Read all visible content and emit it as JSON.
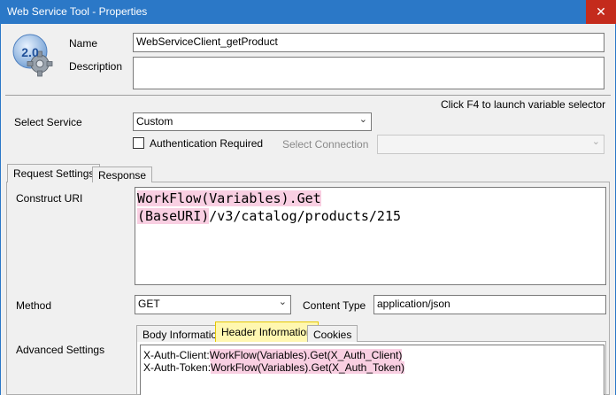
{
  "window": {
    "title": "Web Service Tool - Properties",
    "close_glyph": "✕"
  },
  "icon": {
    "version": "2.0"
  },
  "name": {
    "label": "Name",
    "value": "WebServiceClient_getProduct"
  },
  "description": {
    "label": "Description",
    "value": ""
  },
  "hint": "Click F4 to launch variable selector",
  "service": {
    "label": "Select Service",
    "value": "Custom"
  },
  "auth": {
    "label": "Authentication Required",
    "checked": false
  },
  "connection": {
    "label": "Select Connection",
    "value": ""
  },
  "tabs": {
    "request": "Request Settings",
    "response": "Response"
  },
  "uri": {
    "label": "Construct URI",
    "part1": "WorkFlow(Variables).Get",
    "part2": "(BaseURI)",
    "part3": "/v3/catalog/products/215"
  },
  "method": {
    "label": "Method",
    "value": "GET"
  },
  "content_type": {
    "label": "Content Type",
    "value": "application/json"
  },
  "advanced": {
    "label": "Advanced Settings"
  },
  "subtabs": {
    "body": "Body Information",
    "header": "Header Information",
    "cookies": "Cookies"
  },
  "headers": [
    {
      "key": "X-Auth-Client:",
      "value": "WorkFlow(Variables).Get(X_Auth_Client)"
    },
    {
      "key": "X-Auth-Token:",
      "value": "WorkFlow(Variables).Get(X_Auth_Token)"
    }
  ],
  "colors": {
    "titlebar": "#2b78c7",
    "close": "#c42b1c",
    "variable_highlight": "#f9cfe2",
    "active_subtab": "#fff7b0"
  },
  "icons": {
    "app": "web-service-gear-icon",
    "dropdown": "chevron-down-icon",
    "close": "close-icon"
  }
}
